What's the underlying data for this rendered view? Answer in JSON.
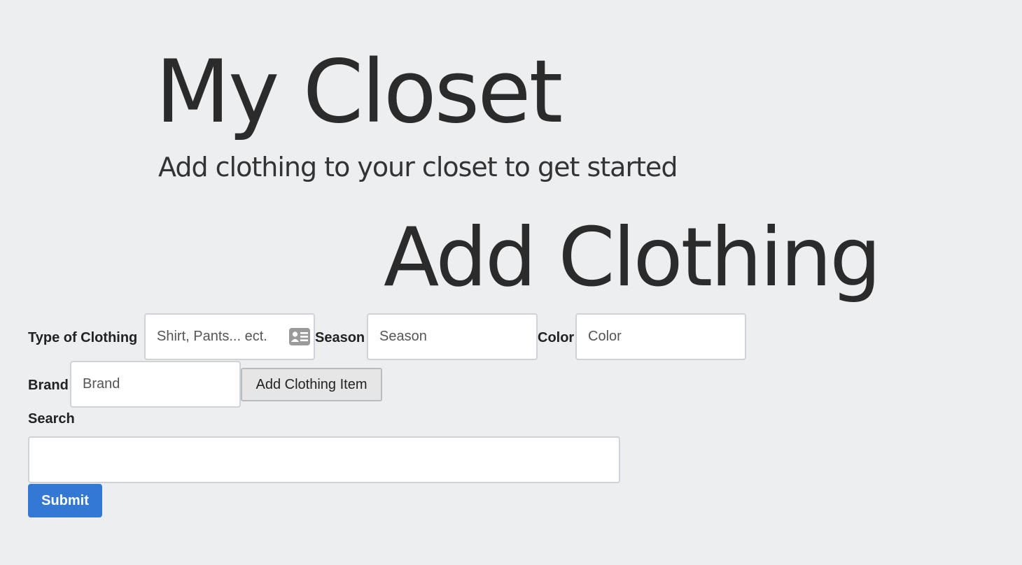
{
  "header": {
    "title": "My Closet",
    "subtitle": "Add clothing to your closet to get started"
  },
  "add_section": {
    "title": "Add Clothing",
    "type_label": "Type of Clothing",
    "type_placeholder": "Shirt, Pants... ect.",
    "type_value": "",
    "type_icon": "contact-card-icon",
    "season_label": "Season",
    "season_placeholder": "Season",
    "season_value": "",
    "color_label": "Color",
    "color_placeholder": "Color",
    "color_value": "",
    "brand_label": "Brand",
    "brand_placeholder": "Brand",
    "brand_value": "",
    "add_button_label": "Add Clothing Item"
  },
  "search": {
    "label": "Search",
    "value": "",
    "placeholder": "",
    "submit_label": "Submit"
  },
  "colors": {
    "background": "#eceef0",
    "submit_button": "#3378d3",
    "text": "#2b2b2b"
  }
}
